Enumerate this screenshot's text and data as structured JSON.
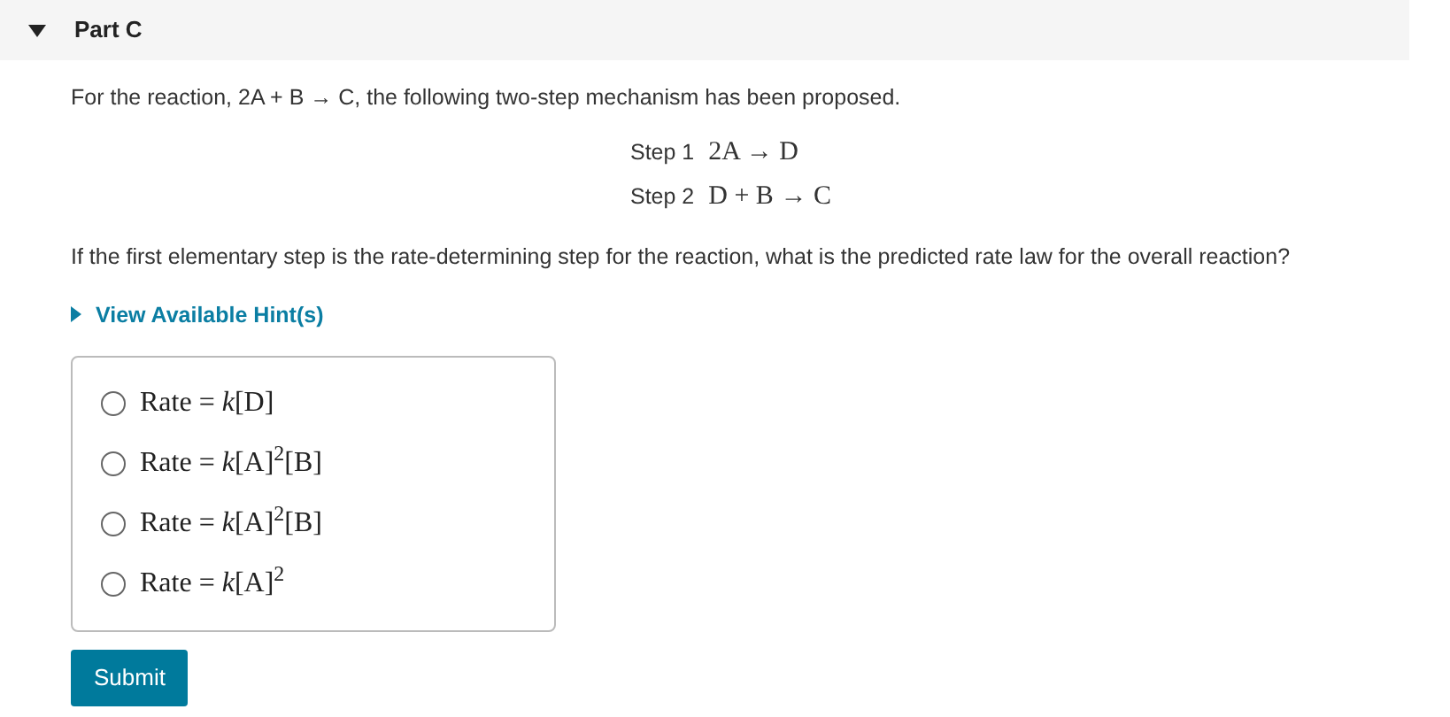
{
  "part": {
    "title": "Part C",
    "expanded": true
  },
  "intro": "For the reaction, 2A + B → C, the following two-step mechanism has been proposed.",
  "steps": [
    {
      "label": "Step 1",
      "equation": "2A → D"
    },
    {
      "label": "Step 2",
      "equation": "D + B → C"
    }
  ],
  "question": "If the first elementary step is the rate-determining step for the reaction, what is the predicted rate law for the overall reaction?",
  "hint_link": {
    "label": "View Available Hint(s)",
    "expanded": false
  },
  "options": [
    {
      "text": "Rate = *k*[D]",
      "selected": false
    },
    {
      "text": "Rate = *k*[A]$^{2}$[B]",
      "selected": false
    },
    {
      "text": "Rate = *k*[A]$^{2}$[B]",
      "selected": false
    },
    {
      "text": "Rate = *k*[A]$^{2}$",
      "selected": false
    }
  ],
  "submit_button": "Submit"
}
